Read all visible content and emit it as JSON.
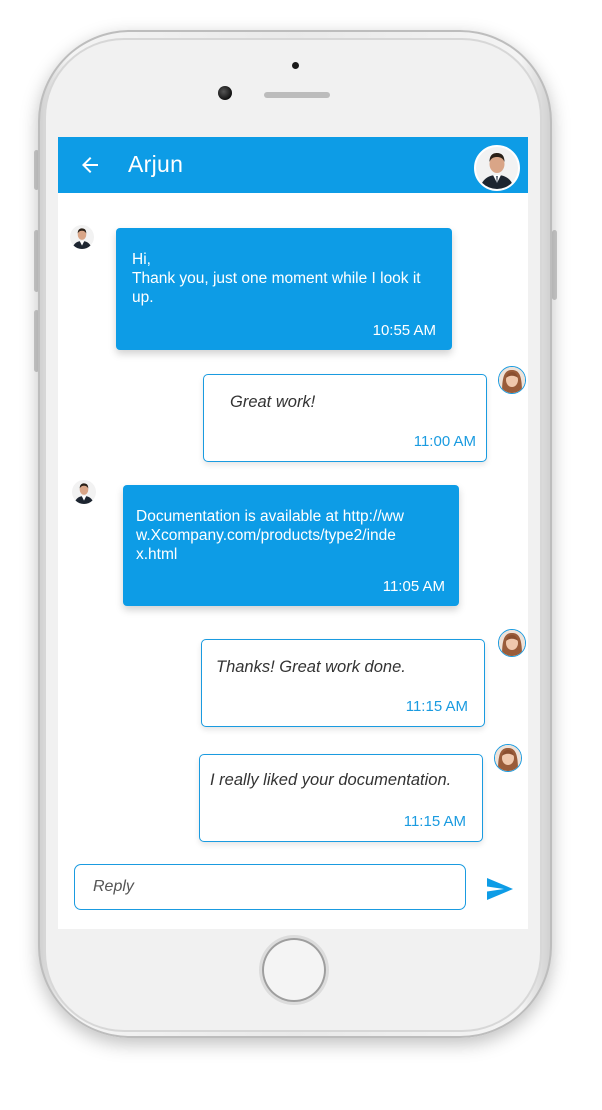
{
  "header": {
    "title": "Arjun"
  },
  "messages": [
    {
      "sender": "agent",
      "text": "Hi,\nThank you, just one moment while I look it up.",
      "time": "10:55 AM"
    },
    {
      "sender": "user",
      "text": "Great work!",
      "time": "11:00 AM"
    },
    {
      "sender": "agent",
      "text": "Documentation is available at http://www.Xcompany.com/products/type2/index.html",
      "time": "11:05 AM"
    },
    {
      "sender": "user",
      "text": "Thanks! Great work done.",
      "time": "11:15 AM"
    },
    {
      "sender": "user",
      "text": "I really liked your documentation.",
      "time": "11:15 AM"
    }
  ],
  "composer": {
    "placeholder": "Reply"
  },
  "icons": {
    "back": "arrow-left-icon",
    "send": "send-icon",
    "header_avatar": "agent-avatar",
    "user_avatar": "user-avatar"
  },
  "colors": {
    "accent": "#0d9ce6",
    "bubble_border": "#1a9be0",
    "agent_text": "#ffffff",
    "user_text": "#333333"
  }
}
